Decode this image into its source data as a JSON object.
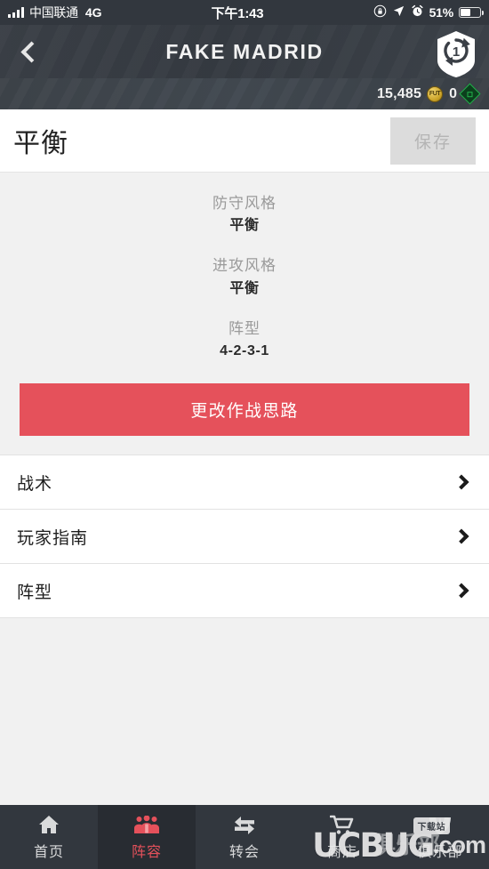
{
  "status_bar": {
    "signal_icon": "signal-bars-icon",
    "carrier": "中国联通",
    "network": "4G",
    "time": "下午1:43",
    "rotation_lock_icon": "rotation-lock-icon",
    "location_icon": "location-arrow-icon",
    "alarm_icon": "alarm-clock-icon",
    "battery_percent": "51%",
    "battery_icon": "battery-icon"
  },
  "header": {
    "back_icon": "back-chevron-icon",
    "title": "FAKE MADRID",
    "club_badge_icon": "club-crest-icon",
    "club_badge_number": "1"
  },
  "currency": {
    "coins": "15,485",
    "coins_icon": "fut-coin-icon",
    "coins_icon_label": "FUT",
    "points": "0",
    "points_icon": "fifa-points-diamond-icon"
  },
  "title_row": {
    "plan_name": "平衡",
    "save_label": "保存",
    "save_disabled": true
  },
  "summary": [
    {
      "label": "防守风格",
      "value": "平衡"
    },
    {
      "label": "进攻风格",
      "value": "平衡"
    },
    {
      "label": "阵型",
      "value": "4-2-3-1"
    }
  ],
  "cta": {
    "label": "更改作战思路",
    "color": "#e5515b"
  },
  "list": [
    {
      "label": "战术",
      "chevron_icon": "chevron-right-icon"
    },
    {
      "label": "玩家指南",
      "chevron_icon": "chevron-right-icon"
    },
    {
      "label": "阵型",
      "chevron_icon": "chevron-right-icon"
    }
  ],
  "tab_bar": {
    "active_index": 1,
    "active_color": "#e5515b",
    "items": [
      {
        "label": "首页",
        "icon": "home-icon"
      },
      {
        "label": "阵容",
        "icon": "squad-people-icon"
      },
      {
        "label": "转会",
        "icon": "transfer-arrows-icon"
      },
      {
        "label": "商店",
        "icon": "shopping-cart-icon"
      },
      {
        "label": "俱乐部",
        "icon": "club-shield-icon"
      }
    ]
  },
  "watermark": {
    "text": "UCBUG",
    "domain": ".com",
    "badge": "下载站",
    "cn_text": "俱乐部"
  }
}
